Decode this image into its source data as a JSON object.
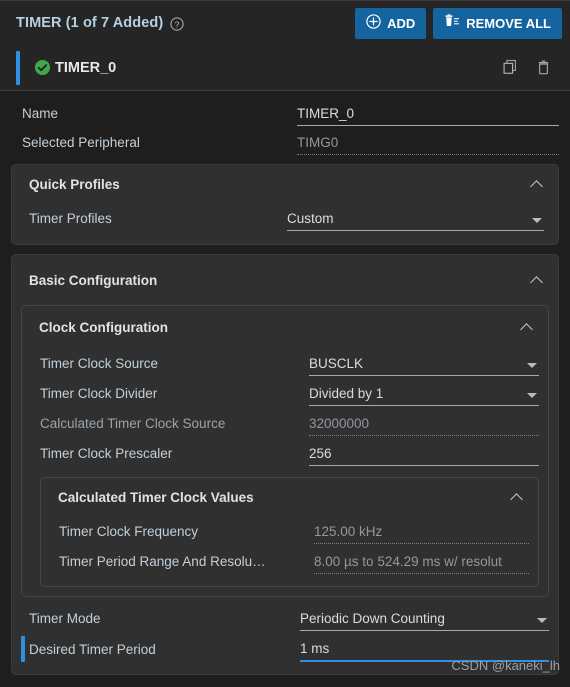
{
  "header": {
    "title": "TIMER (1 of 7 Added)",
    "help_icon": "help-circle-icon",
    "add_label": "ADD",
    "add_icon": "plus-circle-icon",
    "remove_all_label": "REMOVE ALL",
    "remove_all_icon": "trash-list-icon",
    "accent_color": "#1464a0"
  },
  "instance": {
    "name": "TIMER_0",
    "status_icon": "check-circle-icon",
    "status_color": "#3ea94a",
    "accent_color": "#2f8fe0",
    "copy_icon": "copy-icon",
    "delete_icon": "trash-icon"
  },
  "top_fields": [
    {
      "label": "Name",
      "value": "TIMER_0",
      "readonly": false
    },
    {
      "label": "Selected Peripheral",
      "value": "TIMG0",
      "readonly": true
    }
  ],
  "quick_profiles": {
    "title": "Quick Profiles",
    "collapse_icon": "chevron-up-icon",
    "rows": [
      {
        "label": "Timer Profiles",
        "value": "Custom",
        "type": "dropdown"
      }
    ]
  },
  "basic_configuration": {
    "title": "Basic Configuration",
    "collapse_icon": "chevron-up-icon",
    "clock_configuration": {
      "title": "Clock Configuration",
      "collapse_icon": "chevron-up-icon",
      "rows": [
        {
          "label": "Timer Clock Source",
          "value": "BUSCLK",
          "type": "dropdown"
        },
        {
          "label": "Timer Clock Divider",
          "value": "Divided by 1",
          "type": "dropdown"
        },
        {
          "label": "Calculated Timer Clock Source",
          "value": "32000000",
          "type": "readonly"
        },
        {
          "label": "Timer Clock Prescaler",
          "value": "256",
          "type": "text"
        }
      ],
      "calculated_values": {
        "title": "Calculated Timer Clock Values",
        "collapse_icon": "chevron-up-icon",
        "rows": [
          {
            "label": "Timer Clock Frequency",
            "value": "125.00 kHz",
            "type": "readonly"
          },
          {
            "label": "Timer Period Range And Resolutio…",
            "value": "8.00 µs to 524.29 ms w/ resolut",
            "type": "readonly"
          }
        ]
      }
    },
    "rows": [
      {
        "label": "Timer Mode",
        "value": "Periodic Down Counting",
        "type": "dropdown",
        "highlighted": false
      },
      {
        "label": "Desired Timer Period",
        "value": "1 ms",
        "type": "text",
        "highlighted": true
      }
    ]
  },
  "watermark": "CSDN @kaneki_lh"
}
